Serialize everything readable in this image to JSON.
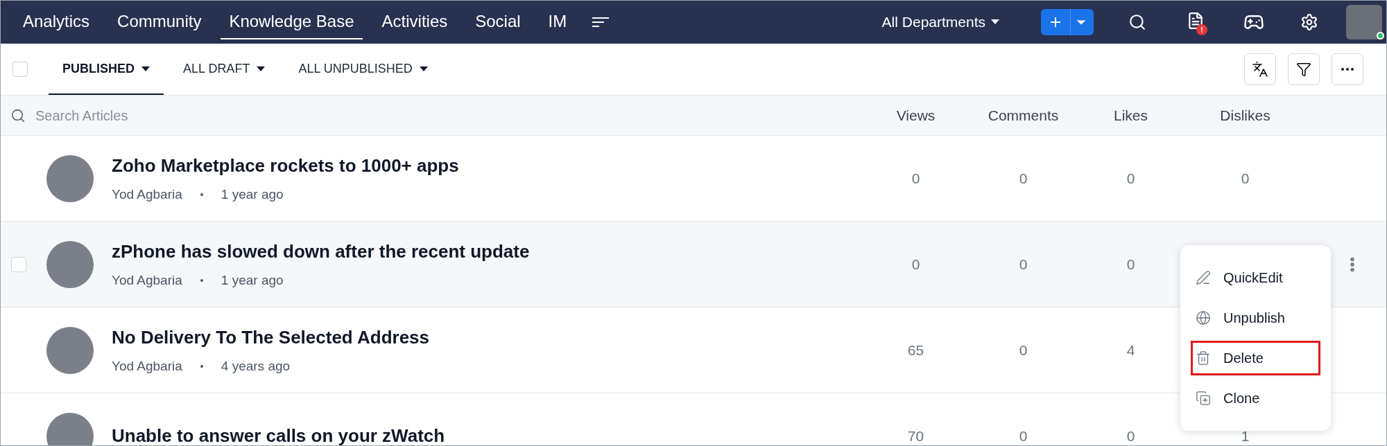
{
  "top_nav": {
    "items": [
      {
        "label": "Analytics",
        "selected": false
      },
      {
        "label": "Community",
        "selected": false
      },
      {
        "label": "Knowledge Base",
        "selected": true
      },
      {
        "label": "Activities",
        "selected": false
      },
      {
        "label": "Social",
        "selected": false
      },
      {
        "label": "IM",
        "selected": false
      }
    ],
    "department": "All Departments",
    "alert_badge": "!",
    "user_online": true
  },
  "tabs": [
    {
      "label": "PUBLISHED",
      "selected": true
    },
    {
      "label": "ALL DRAFT",
      "selected": false
    },
    {
      "label": "ALL UNPUBLISHED",
      "selected": false
    }
  ],
  "select_all_checked": false,
  "search": {
    "placeholder": "Search Articles"
  },
  "columns": [
    "Views",
    "Comments",
    "Likes",
    "Dislikes"
  ],
  "rows": [
    {
      "title": "Zoho Marketplace rockets to 1000+ apps",
      "author": "Yod Agbaria",
      "time": "1 year ago",
      "values": [
        "0",
        "0",
        "0",
        "0"
      ],
      "hovered": false,
      "menu_open": false
    },
    {
      "title": "zPhone has slowed down after the recent update",
      "author": "Yod Agbaria",
      "time": "1 year ago",
      "values": [
        "0",
        "0",
        "0"
      ],
      "hovered": true,
      "menu_open": true
    },
    {
      "title": "No Delivery To The Selected Address",
      "author": "Yod Agbaria",
      "time": "4 years ago",
      "values": [
        "65",
        "0",
        "4"
      ],
      "hovered": false,
      "menu_open": false
    },
    {
      "title": "Unable to answer calls on your zWatch",
      "values": [
        "70",
        "0",
        "0",
        "1"
      ],
      "hovered": false,
      "menu_open": false
    }
  ],
  "row_menu": [
    {
      "kind": "edit",
      "label": "QuickEdit",
      "highlighted": false
    },
    {
      "kind": "unpublish",
      "label": "Unpublish",
      "highlighted": false
    },
    {
      "kind": "delete",
      "label": "Delete",
      "highlighted": true
    },
    {
      "kind": "clone",
      "label": "Clone",
      "highlighted": false
    }
  ]
}
